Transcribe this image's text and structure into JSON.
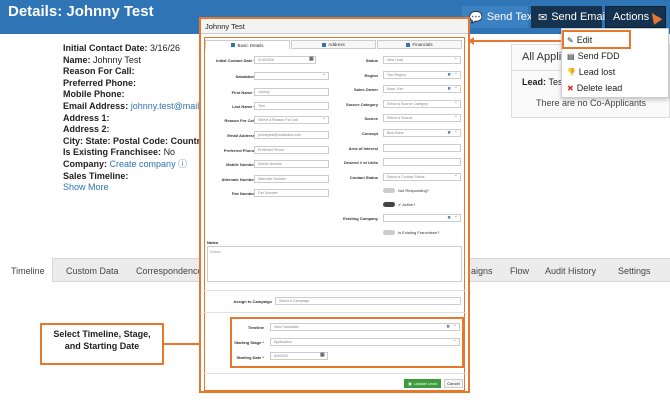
{
  "header": {
    "title": "Details: Johnny Test",
    "send_text": "Send Text",
    "send_email": "Send Email",
    "actions": "Actions"
  },
  "details": {
    "initial_contact_label": "Initial Contact Date:",
    "initial_contact_value": "3/16/26",
    "name_label": "Name:",
    "name_value": "Johnny Test",
    "reason_label": "Reason For Call:",
    "preferred_phone_label": "Preferred Phone:",
    "mobile_phone_label": "Mobile Phone:",
    "email_label": "Email Address:",
    "email_value": "johnny.test@mailin",
    "address1_label": "Address 1:",
    "address2_label": "Address 2:",
    "city_label": "City:",
    "state_label": "State:",
    "postal_label": "Postal Code:",
    "country_label": "Country",
    "franchisee_label": "Is Existing Franchisee:",
    "franchisee_value": "No",
    "company_label": "Company:",
    "company_link": "Create company",
    "sales_timeline_label": "Sales Timeline:",
    "show_more": "Show More"
  },
  "coapplicants": {
    "title": "All Applic",
    "lead_label": "Lead:",
    "lead_value": "Tes",
    "none_text": "There are no Co-Applicants"
  },
  "actions_menu": {
    "items": [
      "Edit",
      "Send FDD",
      "Lead lost",
      "Delete lead"
    ]
  },
  "tabs": [
    "Timeline",
    "Custom Data",
    "Correspondence",
    "aigns",
    "Flow",
    "Audit History",
    "Settings"
  ],
  "callout": {
    "line1": "Select Timeline, Stage,",
    "line2": "and Starting Date"
  },
  "modal": {
    "title": "Johnny Test",
    "tabs": [
      "Basic Details",
      "Address",
      "Financials"
    ],
    "left_fields": [
      {
        "label": "Initial Contact Date *",
        "value": "3/16/2026"
      },
      {
        "label": "Salutation",
        "value": ""
      },
      {
        "label": "First Name *",
        "value": "Johnny"
      },
      {
        "label": "Last Name *",
        "value": "Test"
      },
      {
        "label": "Reason For Call",
        "value": "Select a Reason For Call"
      },
      {
        "label": "Email Address",
        "value": "johnnytest@mailinator.com"
      },
      {
        "label": "Preferred Phone",
        "value": "Preferred Phone"
      },
      {
        "label": "Mobile Number",
        "value": "Mobile Number"
      },
      {
        "label": "Alternate Number",
        "value": "Alternate Number"
      },
      {
        "label": "Fax Number",
        "value": "Fax Number"
      }
    ],
    "right_fields": [
      {
        "label": "Status",
        "value": "New Lead"
      },
      {
        "label": "Region",
        "value": "Test Region"
      },
      {
        "label": "Sales Owner",
        "value": "Kase, Kim"
      },
      {
        "label": "Source Category",
        "value": "Select a Source Category"
      },
      {
        "label": "Source",
        "value": "Select a Source"
      },
      {
        "label": "Concept",
        "value": "Best Brew"
      },
      {
        "label": "Area of Interest",
        "value": ""
      },
      {
        "label": "Desired # of Units",
        "value": ""
      },
      {
        "label": "Contact Status",
        "value": "Select a Contact Status"
      }
    ],
    "not_responding": "Not Responding?",
    "active": "Active?",
    "existing_company_label": "Existing Company",
    "is_existing_franchisee": "Is Existing Franchisee?",
    "notes_label": "Notes",
    "notes_placeholder": "Notes",
    "assign_campaign_label": "Assign to Campaign",
    "assign_campaign_value": "Select a Campaign",
    "timeline_label": "Timeline",
    "timeline_value": "New Candidate",
    "stage_label": "Starting Stage *",
    "stage_value": "Application",
    "date_label": "Starting Date *",
    "date_value": "8/5/2020",
    "update_button": "Update Lead",
    "cancel_button": "Cancel"
  },
  "colors": {
    "header_blue": "#2f74b5",
    "dark_button": "#15324f",
    "highlight_orange": "#e8772e",
    "update_green": "#3d9b3d"
  }
}
